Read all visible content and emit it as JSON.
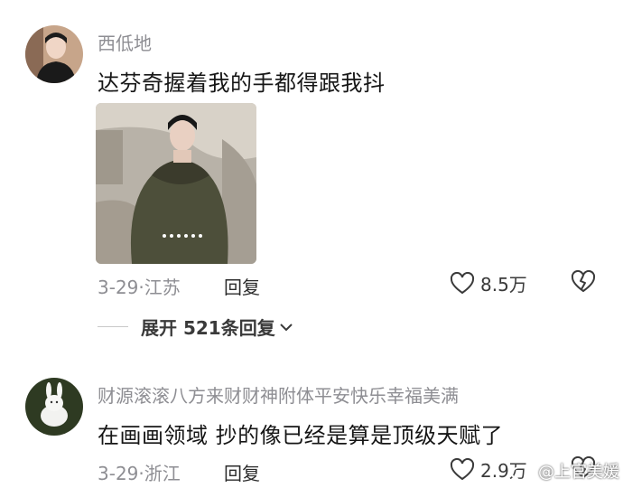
{
  "comments": [
    {
      "username": "西低地",
      "text": "达芬奇握着我的手都得跟我抖",
      "date": "3-29",
      "location": "江苏",
      "reply_label": "回复",
      "likes": "8.5万"
    },
    {
      "username": "财源滚滚八方来财财神附体平安快乐幸福美满",
      "text": "在画画领域 抄的像已经是算是顶级天赋了",
      "date": "3-29",
      "location": "浙江",
      "reply_label": "回复",
      "likes": "2.9万"
    }
  ],
  "expand": {
    "label": "展开 521条回复"
  },
  "watermark": {
    "text": "@上官美媛"
  },
  "colors": {
    "secondary_text": "#8e8e93",
    "primary_text": "#161616"
  },
  "icons": {
    "like": "heart-outline-icon",
    "dislike": "broken-heart-icon",
    "expand": "chevron-down-icon",
    "watermark": "weibo-logo-icon"
  }
}
